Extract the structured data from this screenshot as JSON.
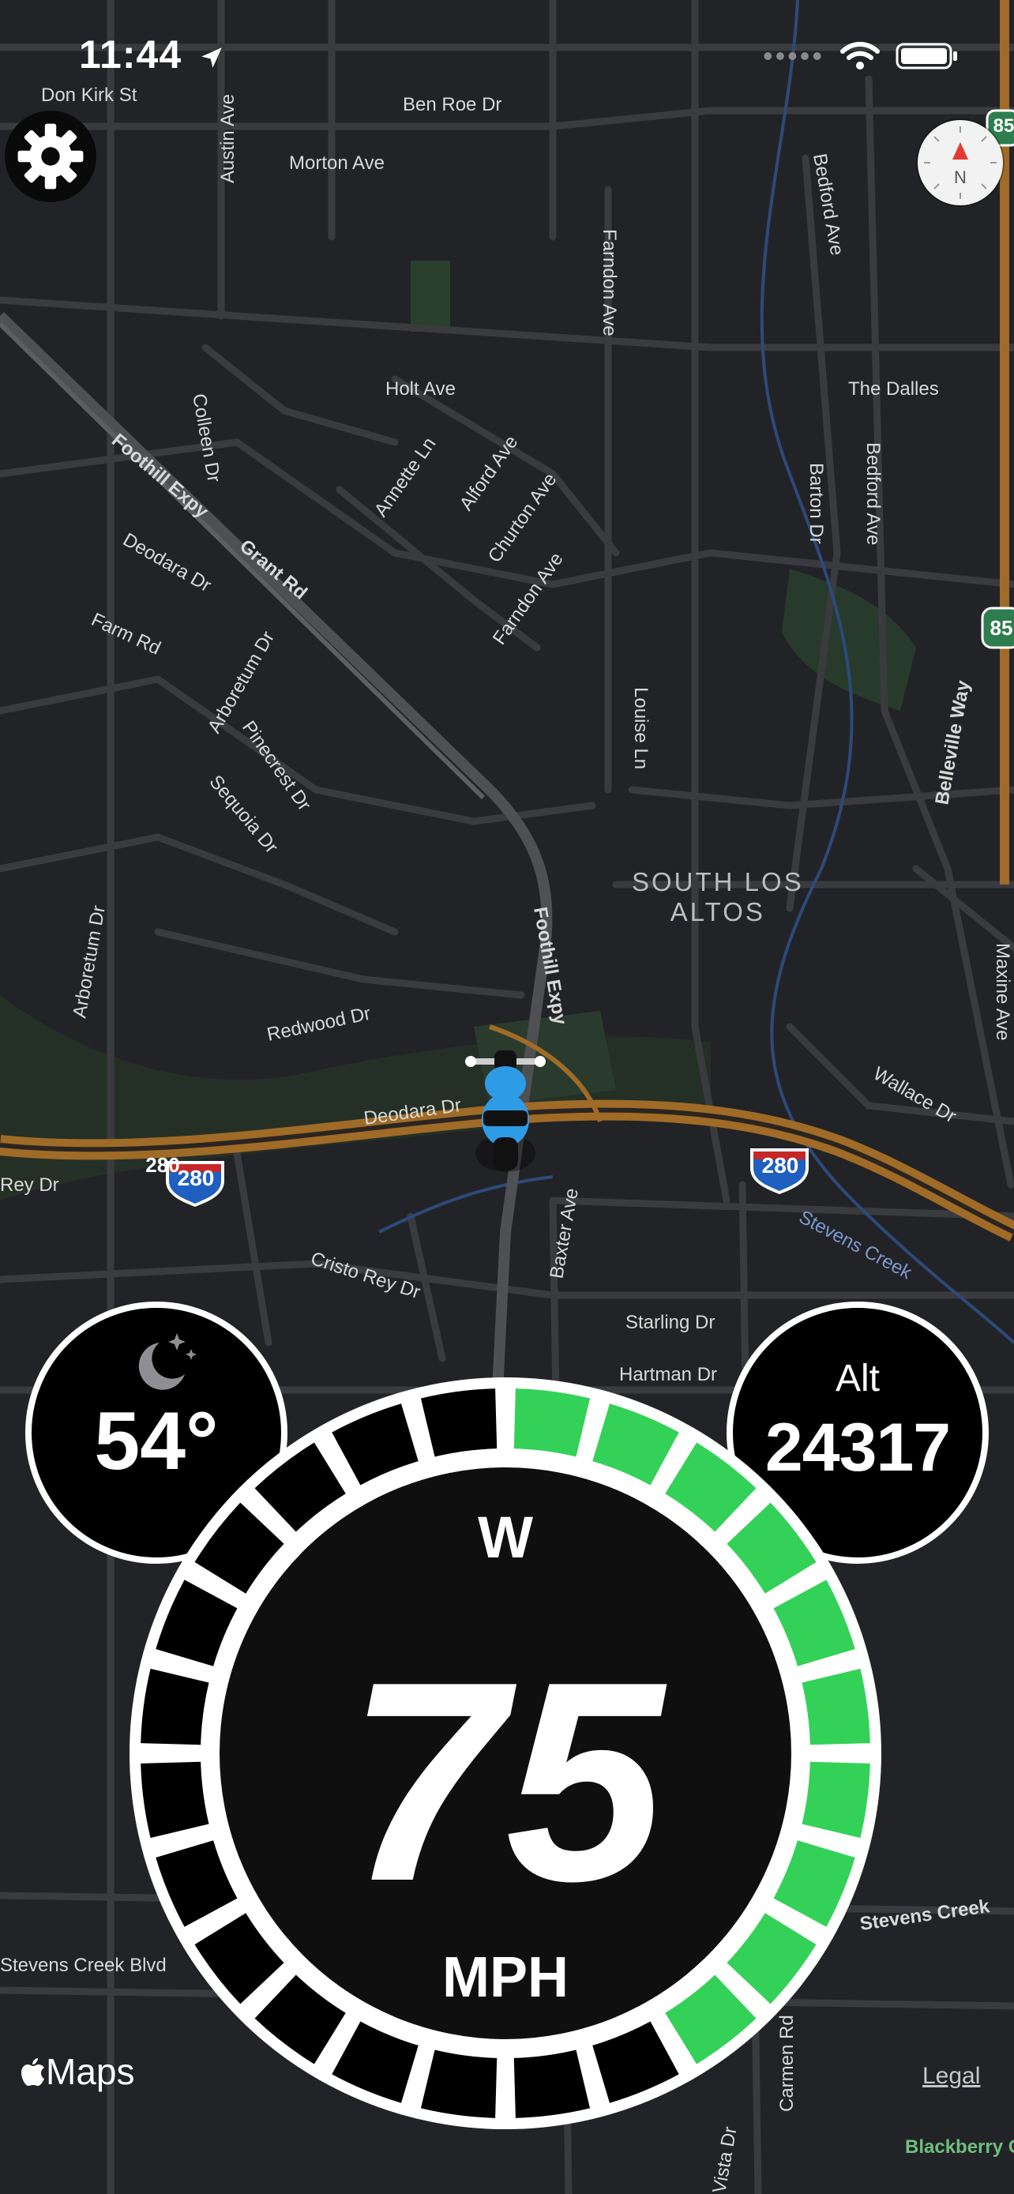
{
  "status": {
    "time": "11:44"
  },
  "map": {
    "street_labels": [
      {
        "text": "Don Kirk St",
        "style": "normal"
      },
      {
        "text": "Ben Roe Dr",
        "style": "normal"
      },
      {
        "text": "Morton Ave",
        "style": "normal"
      },
      {
        "text": "Austin Ave",
        "style": "normal"
      },
      {
        "text": "Bedford Ave",
        "style": "normal"
      },
      {
        "text": "Farndon Ave",
        "style": "normal"
      },
      {
        "text": "Holt Ave",
        "style": "normal"
      },
      {
        "text": "The Dalles",
        "style": "normal"
      },
      {
        "text": "Colleen Dr",
        "style": "normal"
      },
      {
        "text": "Foothill Expy",
        "style": "bold"
      },
      {
        "text": "Annette Ln",
        "style": "normal"
      },
      {
        "text": "Alford Ave",
        "style": "normal"
      },
      {
        "text": "Barton Dr",
        "style": "normal"
      },
      {
        "text": "Bedford Ave",
        "style": "normal"
      },
      {
        "text": "Churton Ave",
        "style": "normal"
      },
      {
        "text": "Deodara Dr",
        "style": "normal"
      },
      {
        "text": "Grant Rd",
        "style": "bold"
      },
      {
        "text": "Farndon Ave",
        "style": "normal"
      },
      {
        "text": "Farm Rd",
        "style": "normal"
      },
      {
        "text": "Arboretum Dr",
        "style": "normal"
      },
      {
        "text": "Pinecrest Dr",
        "style": "normal"
      },
      {
        "text": "Louise Ln",
        "style": "normal"
      },
      {
        "text": "Belleville Way",
        "style": "bold"
      },
      {
        "text": "Sequoia Dr",
        "style": "normal"
      },
      {
        "text": "Arboretum Dr",
        "style": "normal"
      },
      {
        "text": "Foothill Expy",
        "style": "bold"
      },
      {
        "text": "Maxine Ave",
        "style": "normal"
      },
      {
        "text": "Redwood Dr",
        "style": "normal"
      },
      {
        "text": "Wallace Dr",
        "style": "normal"
      },
      {
        "text": "Deodara Dr",
        "style": "normal"
      },
      {
        "text": "Rey Dr",
        "style": "normal"
      },
      {
        "text": "Baxter Ave",
        "style": "normal"
      },
      {
        "text": "Cristo Rey Dr",
        "style": "normal"
      },
      {
        "text": "Stevens Creek",
        "style": "water"
      },
      {
        "text": "Starling Dr",
        "style": "normal"
      },
      {
        "text": "Hartman Dr",
        "style": "normal"
      },
      {
        "text": "Stevens Creek Blvd",
        "style": "normal"
      },
      {
        "text": "Stevens Creek",
        "style": "normal"
      },
      {
        "text": "Vista Dr",
        "style": "normal"
      },
      {
        "text": "Carmen Rd",
        "style": "normal"
      },
      {
        "text": "Blackberry Golf Co",
        "style": "green"
      }
    ],
    "district": "SOUTH LOS\nALTOS",
    "shields": [
      "280",
      "280"
    ],
    "route_shields": [
      "85",
      "85"
    ]
  },
  "weather": {
    "temperature": "54°",
    "icon": "moon-stars-icon"
  },
  "altitude": {
    "label": "Alt",
    "value": "24317"
  },
  "speedometer": {
    "heading": "W",
    "speed": "75",
    "unit": "MPH",
    "segments_total": 24,
    "segments_lit": 10,
    "lit_color": "#34d158",
    "unlit_color": "#000000",
    "ring_color": "#ffffff"
  },
  "footer": {
    "maps_logo": "Maps",
    "legal": "Legal"
  },
  "colors": {
    "map_bg": "#222326",
    "highway": "#a06b26",
    "road": "#3a3b3e",
    "accent": "#2e9be6"
  }
}
